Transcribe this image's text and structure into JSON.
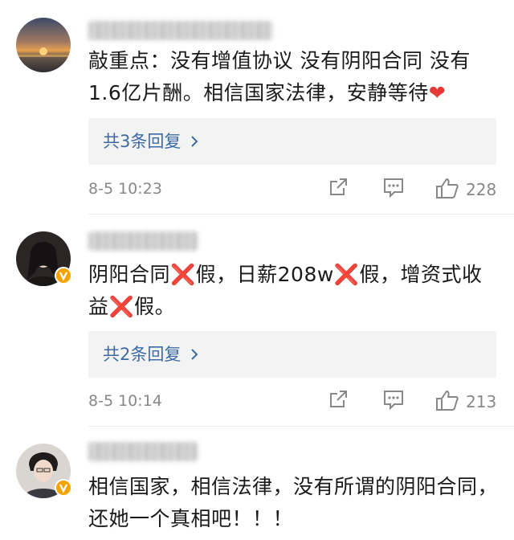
{
  "comments": [
    {
      "text": "敲重点：没有增值协议  没有阴阳合同   没有1.6亿片酬。相信国家法律，安静等待",
      "heart": "❤",
      "reply_label": "共3条回复",
      "time": "8-5 10:23",
      "likes": "228",
      "verified": false
    },
    {
      "text_parts": [
        "阴阳合同",
        "❌",
        "假，日薪208w",
        "❌",
        "假，增资式收益",
        "❌",
        "假。"
      ],
      "reply_label": "共2条回复",
      "time": "8-5 10:14",
      "likes": "213",
      "verified": true
    },
    {
      "text": "相信国家，相信法律，没有所谓的阴阳合同，还她一个真相吧！！！",
      "verified": true
    }
  ],
  "icons": {
    "share": "share-icon",
    "reply": "comment-icon",
    "like": "thumbs-up-icon",
    "more": "chevron-right-icon",
    "verified": "verified-badge-icon"
  },
  "colors": {
    "link": "#3d6aa6",
    "meta": "#888888",
    "reply_bg": "#f3f3f3",
    "verified": "#f5a300",
    "cross": "#e0332b"
  }
}
